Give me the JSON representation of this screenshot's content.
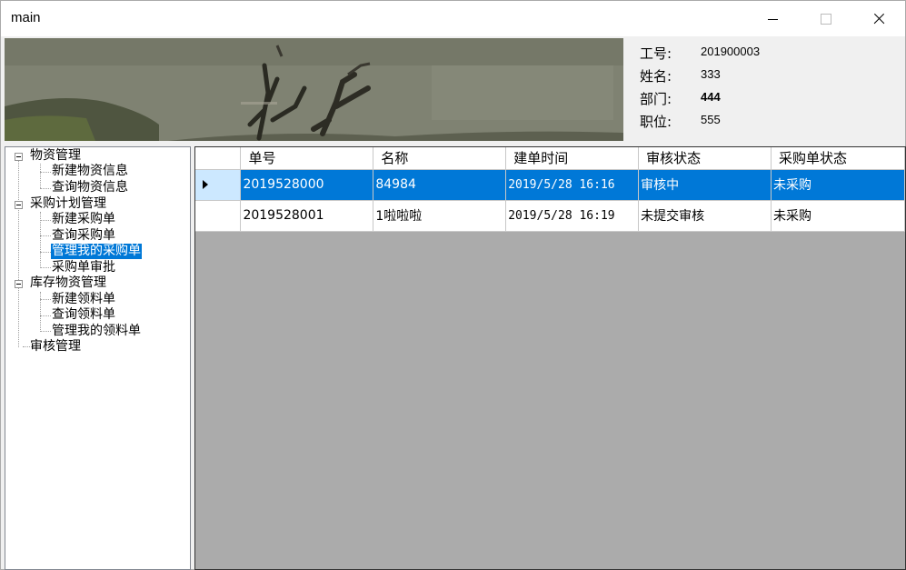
{
  "window": {
    "title": "main"
  },
  "info": {
    "rows": [
      {
        "label": "工号:",
        "value": "201900003"
      },
      {
        "label": "姓名:",
        "value": "333"
      },
      {
        "label": "部门:",
        "value": "444"
      },
      {
        "label": "职位:",
        "value": "555"
      }
    ]
  },
  "tree": {
    "groups": [
      {
        "label": "物资管理",
        "children": [
          "新建物资信息",
          "查询物资信息"
        ]
      },
      {
        "label": "采购计划管理",
        "children": [
          "新建采购单",
          "查询采购单",
          "管理我的采购单",
          "采购单审批"
        ]
      },
      {
        "label": "库存物资管理",
        "children": [
          "新建领料单",
          "查询领料单",
          "管理我的领料单"
        ]
      },
      {
        "label": "审核管理",
        "children": []
      }
    ],
    "selected": "管理我的采购单"
  },
  "grid": {
    "columns": [
      "单号",
      "名称",
      "建单时间",
      "审核状态",
      "采购单状态"
    ],
    "rows": [
      [
        "2019528000",
        "84984",
        "2019/5/28 16:16",
        "审核中",
        "未采购"
      ],
      [
        "2019528001",
        "1啦啦啦",
        "2019/5/28 16:19",
        "未提交审核",
        "未采购"
      ]
    ],
    "selected_row": 0
  },
  "colors": {
    "selection": "#0078d7",
    "grid_background": "#ababab"
  }
}
